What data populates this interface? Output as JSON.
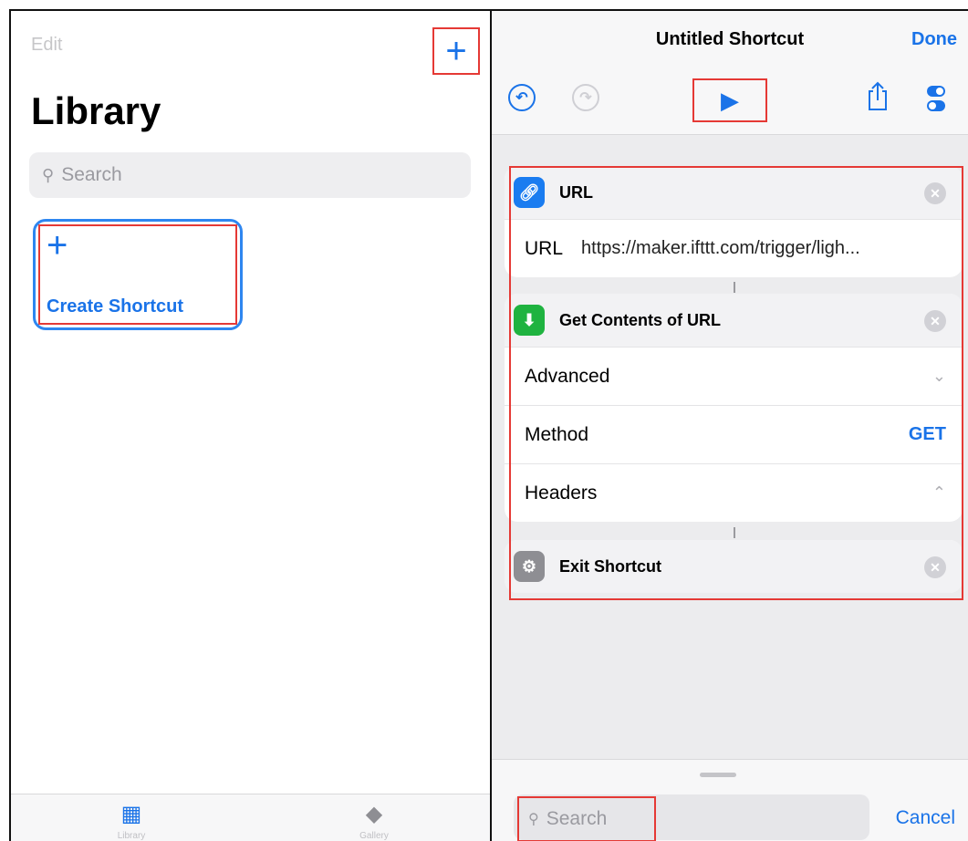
{
  "library": {
    "edit_label": "Edit",
    "add_icon": "plus-icon",
    "title": "Library",
    "search_placeholder": "Search",
    "create_shortcut_label": "Create Shortcut",
    "tabs": [
      {
        "label": "Library",
        "icon": "grid-icon"
      },
      {
        "label": "Gallery",
        "icon": "layers-icon"
      }
    ]
  },
  "editor": {
    "title": "Untitled Shortcut",
    "done_label": "Done",
    "actions": [
      {
        "title": "URL",
        "icon": "link-icon",
        "icon_color": "#1a7cf0",
        "rows": [
          {
            "label": "URL",
            "value": "https://maker.ifttt.com/trigger/ligh..."
          }
        ]
      },
      {
        "title": "Get Contents of URL",
        "icon": "download-arrow-icon",
        "icon_color": "#1fb340",
        "rows": [
          {
            "label": "Advanced",
            "value": "",
            "indicator": "chevron-down-icon"
          },
          {
            "label": "Method",
            "value": "GET"
          },
          {
            "label": "Headers",
            "value": "",
            "indicator": "chevron-up-icon"
          }
        ]
      },
      {
        "title": "Exit Shortcut",
        "icon": "gear-icon",
        "icon_color": "#8e8e93",
        "rows": []
      }
    ],
    "search_placeholder": "Search",
    "cancel_label": "Cancel"
  },
  "colors": {
    "accent": "#1a73e8",
    "highlight": "#e53935"
  }
}
